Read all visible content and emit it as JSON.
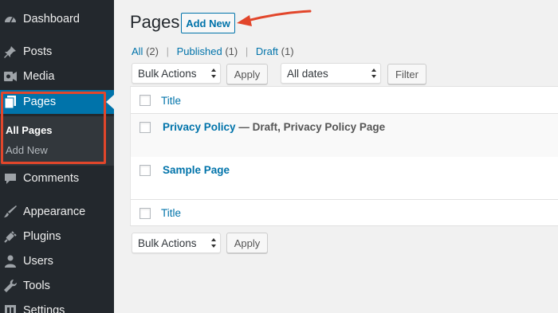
{
  "sidebar": {
    "items": [
      {
        "label": "Dashboard",
        "icon": "dashboard-icon"
      },
      {
        "label": "Posts",
        "icon": "pin-icon"
      },
      {
        "label": "Media",
        "icon": "media-icon"
      },
      {
        "label": "Pages",
        "icon": "pages-icon"
      },
      {
        "label": "Comments",
        "icon": "comments-icon"
      },
      {
        "label": "Appearance",
        "icon": "brush-icon"
      },
      {
        "label": "Plugins",
        "icon": "plugin-icon"
      },
      {
        "label": "Users",
        "icon": "users-icon"
      },
      {
        "label": "Tools",
        "icon": "wrench-icon"
      },
      {
        "label": "Settings",
        "icon": "settings-icon"
      }
    ],
    "submenu": [
      "All Pages",
      "Add New"
    ]
  },
  "header": {
    "title": "Pages",
    "add_new": "Add New"
  },
  "filters": {
    "all": "All",
    "all_count": "(2)",
    "published": "Published",
    "published_count": "(1)",
    "draft": "Draft",
    "draft_count": "(1)",
    "separator": "|"
  },
  "toolbar": {
    "bulk_actions": "Bulk Actions",
    "apply": "Apply",
    "dates": "All dates",
    "filter": "Filter"
  },
  "table": {
    "column_title": "Title",
    "rows": [
      {
        "title": "Privacy Policy",
        "state": " — Draft, Privacy Policy Page"
      },
      {
        "title": "Sample Page",
        "state": ""
      }
    ],
    "footer_title": "Title"
  },
  "colors": {
    "sidebar_bg": "#23282d",
    "accent": "#0073aa",
    "annotation": "#e2462b",
    "page_bg": "#f1f1f1"
  }
}
